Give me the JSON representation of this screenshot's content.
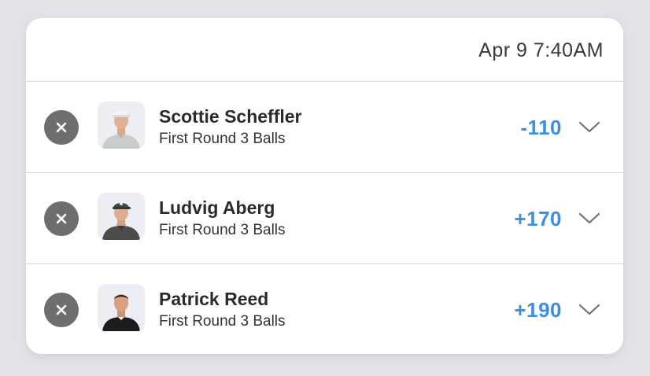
{
  "header": {
    "timestamp": "Apr 9 7:40AM"
  },
  "selections": [
    {
      "player": "Scottie Scheffler",
      "market": "First Round 3 Balls",
      "odds": "-110"
    },
    {
      "player": "Ludvig Aberg",
      "market": "First Round 3 Balls",
      "odds": "+170"
    },
    {
      "player": "Patrick Reed",
      "market": "First Round 3 Balls",
      "odds": "+190"
    }
  ],
  "colors": {
    "odds": "#3d8fe0",
    "remove_button": "#6e6e6e",
    "background": "#e2e3e8",
    "card": "#ffffff"
  },
  "icons": {
    "remove": "close-icon",
    "expand": "chevron-down-icon",
    "avatar": "player-photo"
  }
}
